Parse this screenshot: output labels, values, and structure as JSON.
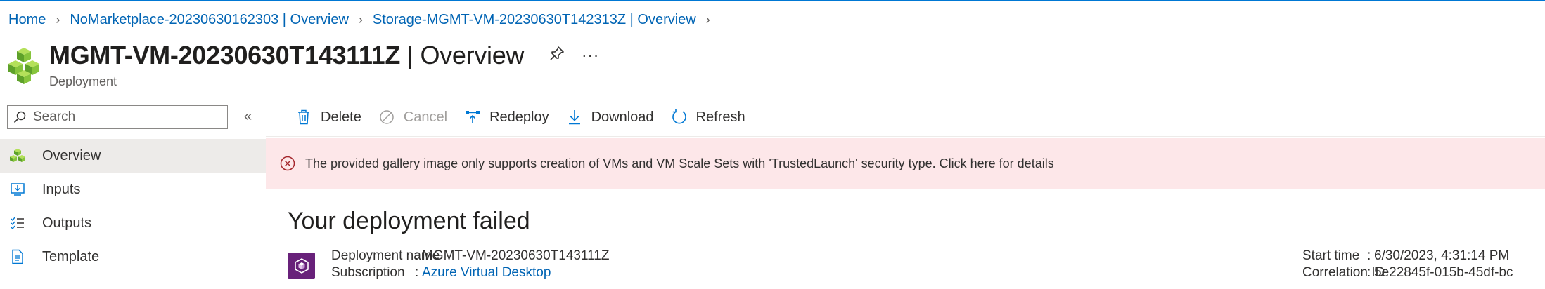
{
  "breadcrumb": [
    {
      "label": "Home"
    },
    {
      "label": "NoMarketplace-20230630162303 | Overview"
    },
    {
      "label": "Storage-MGMT-VM-20230630T142313Z | Overview"
    }
  ],
  "header": {
    "title_main": "MGMT-VM-20230630T143111Z",
    "title_suffix": " | Overview",
    "subtitle": "Deployment",
    "pin_icon": "pin-icon",
    "more_label": "···"
  },
  "sidebar": {
    "search_placeholder": "Search",
    "collapse_label": "«",
    "items": [
      {
        "label": "Overview",
        "icon": "cubes-icon",
        "active": true
      },
      {
        "label": "Inputs",
        "icon": "inputs-icon"
      },
      {
        "label": "Outputs",
        "icon": "outputs-icon"
      },
      {
        "label": "Template",
        "icon": "template-icon"
      }
    ]
  },
  "toolbar": {
    "delete": "Delete",
    "cancel": "Cancel",
    "redeploy": "Redeploy",
    "download": "Download",
    "refresh": "Refresh"
  },
  "error": {
    "message": "The provided gallery image only supports creation of VMs and VM Scale Sets with 'TrustedLaunch' security type. Click here for details"
  },
  "main": {
    "status_title": "Your deployment failed",
    "details": {
      "deployment_name_label": "Deployment name",
      "deployment_name": "MGMT-VM-20230630T143111Z",
      "subscription_label": "Subscription",
      "subscription": "Azure Virtual Desktop",
      "start_time_label": "Start time",
      "start_time": "6/30/2023, 4:31:14 PM",
      "correlation_label": "Correlation ID",
      "correlation_id": "5e22845f-015b-45df-bc"
    }
  },
  "colors": {
    "accent": "#0078d4",
    "link": "#0064b4",
    "error_bg": "#fde7e9",
    "error_icon": "#a4262c",
    "deployment_icon_bg": "#68217a"
  }
}
